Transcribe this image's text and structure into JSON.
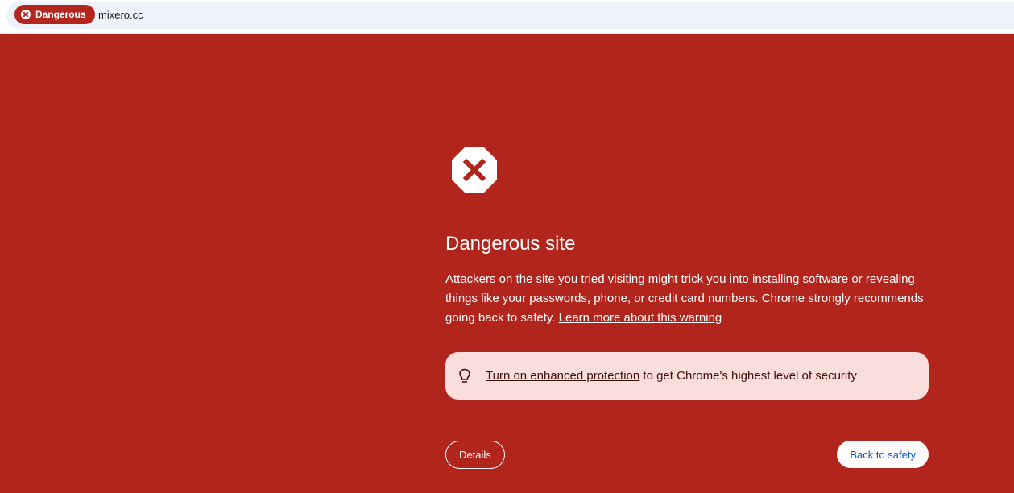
{
  "address_bar": {
    "security_chip_label": "Dangerous",
    "security_chip_icon": "error-circle-icon",
    "url": "mixero.cc"
  },
  "interstitial": {
    "icon": "stop-sign-x-icon",
    "title": "Dangerous site",
    "body_text": "Attackers on the site you tried visiting might trick you into installing software or revealing things like your passwords, phone, or credit card numbers. Chrome strongly recommends going back to safety. ",
    "learn_more_link": "Learn more about this warning",
    "protection_callout": {
      "icon": "lightbulb-icon",
      "link_text": "Turn on enhanced protection",
      "suffix_text": " to get Chrome's highest level of security"
    },
    "details_button": "Details",
    "back_button": "Back to safety"
  },
  "colors": {
    "background": "#b2251d",
    "chip": "#b3261e",
    "callout_bg": "#f9dedc",
    "primary_link": "#0b57d0"
  }
}
